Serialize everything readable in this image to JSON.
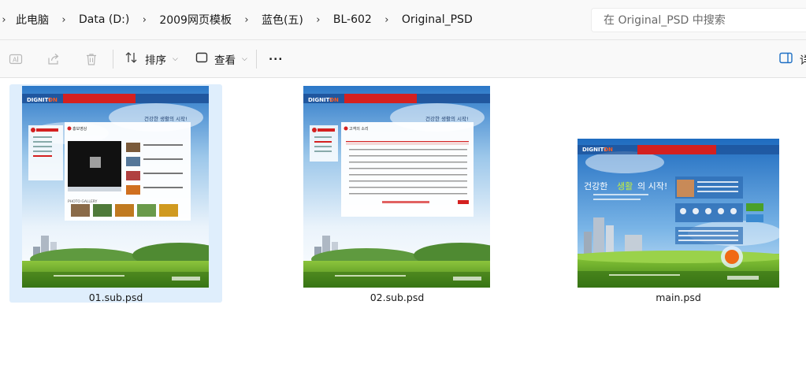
{
  "breadcrumb": {
    "items": [
      "此电脑",
      "Data (D:)",
      "2009网页模板",
      "蓝色(五)",
      "BL-602",
      "Original_PSD"
    ]
  },
  "search": {
    "placeholder": "在 Original_PSD 中搜索"
  },
  "toolbar": {
    "sort_label": "排序",
    "view_label": "查看",
    "more_label": "...",
    "details_label": "详"
  },
  "files": [
    {
      "name": "01.sub.psd",
      "selected": true,
      "logo": "DIGNITI",
      "logo_accent": "ON",
      "slogan": "건강한 생활의 시작!",
      "panel_title": "홍보영상",
      "gallery_label": "PHOTO GALLERY"
    },
    {
      "name": "02.sub.psd",
      "selected": false,
      "logo": "DIGNITI",
      "logo_accent": "ON",
      "slogan": "건강한 생활의 시작!",
      "panel_title": "고객의 소리"
    },
    {
      "name": "main.psd",
      "selected": false,
      "logo": "DIGNITI",
      "logo_accent": "ON",
      "slogan_a": "건강한",
      "slogan_b": "생활",
      "slogan_c": "의 시작!"
    }
  ],
  "colors": {
    "selection": "#dfeefc",
    "sky_top": "#2f7fd0",
    "grass": "#6fae2c",
    "accent_red": "#d42020"
  }
}
